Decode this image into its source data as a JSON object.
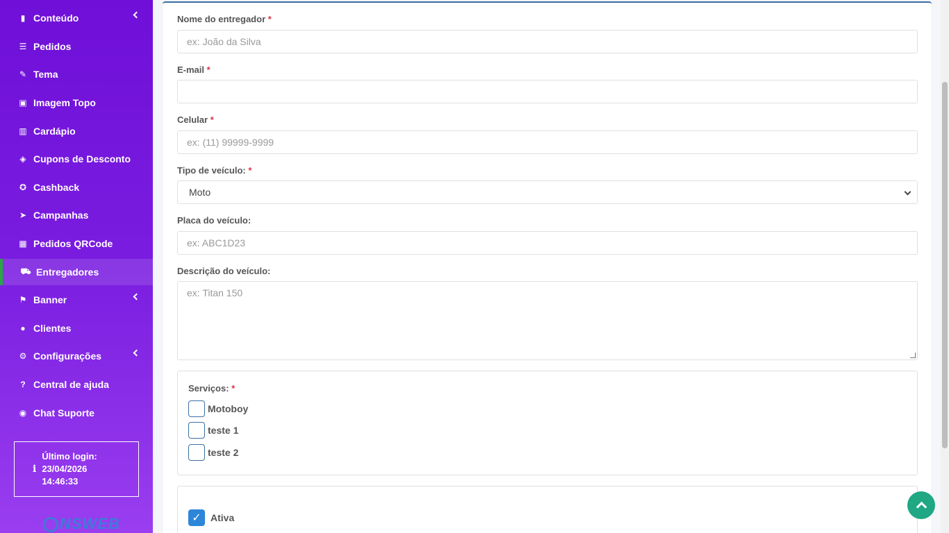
{
  "sidebar": {
    "items": [
      {
        "label": "Conteúdo",
        "icon": "file-icon",
        "glyph": "▮",
        "chevron": true
      },
      {
        "label": "Pedidos",
        "icon": "orders-icon",
        "glyph": "☰",
        "chevron": false
      },
      {
        "label": "Tema",
        "icon": "brush-icon",
        "glyph": "✎",
        "chevron": false
      },
      {
        "label": "Imagem Topo",
        "icon": "image-icon",
        "glyph": "▣",
        "chevron": false
      },
      {
        "label": "Cardápio",
        "icon": "book-icon",
        "glyph": "▥",
        "chevron": false
      },
      {
        "label": "Cupons de Desconto",
        "icon": "tags-icon",
        "glyph": "◈",
        "chevron": false
      },
      {
        "label": "Cashback",
        "icon": "award-icon",
        "glyph": "✪",
        "chevron": false
      },
      {
        "label": "Campanhas",
        "icon": "paper-plane-icon",
        "glyph": "➤",
        "chevron": false
      },
      {
        "label": "Pedidos QRCode",
        "icon": "qrcode-icon",
        "glyph": "▦",
        "chevron": false
      },
      {
        "label": "Entregadores",
        "icon": "motorcycle-icon",
        "glyph": "⛟",
        "chevron": false,
        "active": true
      },
      {
        "label": "Banner",
        "icon": "flag-icon",
        "glyph": "⚑",
        "chevron": true
      },
      {
        "label": "Clientes",
        "icon": "user-icon",
        "glyph": "●",
        "chevron": false
      },
      {
        "label": "Configurações",
        "icon": "gear-icon",
        "glyph": "⚙",
        "chevron": true
      },
      {
        "label": "Central de ajuda",
        "icon": "question-icon",
        "glyph": "?",
        "chevron": false
      },
      {
        "label": "Chat Suporte",
        "icon": "whatsapp-icon",
        "glyph": "◉",
        "chevron": false
      }
    ],
    "last_login": {
      "label": "Último login:",
      "date": "23/04/2026",
      "time": "14:46:33"
    },
    "logo_text": "NSWEB"
  },
  "form": {
    "name": {
      "label": "Nome do entregador",
      "required": "*",
      "placeholder": "ex: João da Silva"
    },
    "email": {
      "label": "E-mail",
      "required": "*",
      "placeholder": ""
    },
    "phone": {
      "label": "Celular",
      "required": "*",
      "placeholder": "ex: (11) 99999-9999"
    },
    "vehicle_type": {
      "label": "Tipo de veículo:",
      "required": "*",
      "value": "Moto"
    },
    "plate": {
      "label": "Placa do veículo:",
      "placeholder": "ex: ABC1D23"
    },
    "description": {
      "label": "Descrição do veículo:",
      "placeholder": "ex: Titan 150"
    },
    "services": {
      "label": "Serviços:",
      "required": "*",
      "options": [
        {
          "label": "Motoboy",
          "checked": false
        },
        {
          "label": "teste 1",
          "checked": false
        },
        {
          "label": "teste 2",
          "checked": false
        }
      ]
    },
    "active": {
      "label": "Ativa",
      "checked": true,
      "mark": "✓"
    }
  },
  "colors": {
    "sidebar_top": "#6f0fd8",
    "sidebar_bottom": "#9a3ef0",
    "active_indicator": "#28a745",
    "required": "#dc3545",
    "checkbox_checked": "#2d86d8",
    "scroll_top_button": "#20a783"
  }
}
